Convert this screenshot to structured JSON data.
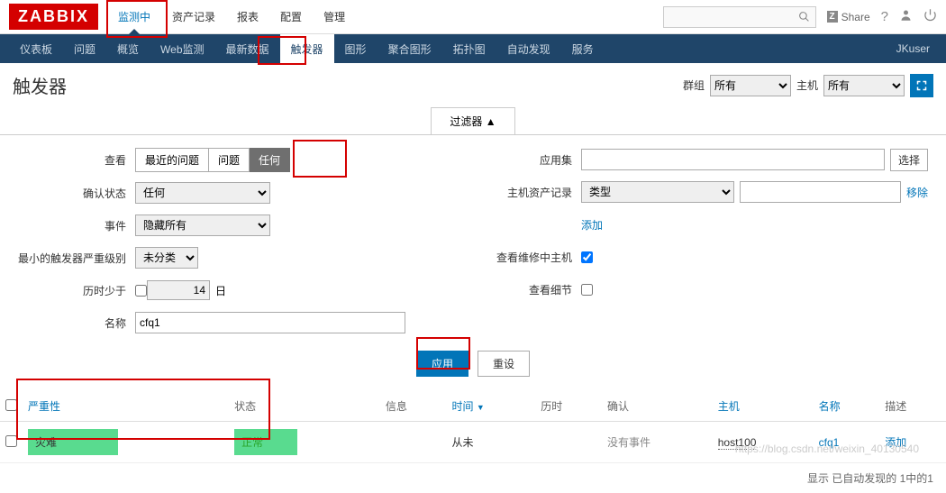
{
  "logo": "ZABBIX",
  "top_menu": [
    "监测中",
    "资产记录",
    "报表",
    "配置",
    "管理"
  ],
  "top_active_index": 0,
  "share_label": "Share",
  "sub_nav": [
    "仪表板",
    "问题",
    "概览",
    "Web监测",
    "最新数据",
    "触发器",
    "图形",
    "聚合图形",
    "拓扑图",
    "自动发现",
    "服务"
  ],
  "sub_active_index": 5,
  "username": "JKuser",
  "page_title": "触发器",
  "header_group_label": "群组",
  "header_group_value": "所有",
  "header_host_label": "主机",
  "header_host_value": "所有",
  "filter_tab": "过滤器 ▲",
  "filter": {
    "view_label": "查看",
    "view_options": [
      "最近的问题",
      "问题",
      "任何"
    ],
    "view_active": 2,
    "ack_label": "确认状态",
    "ack_value": "任何",
    "events_label": "事件",
    "events_value": "隐藏所有",
    "min_sev_label": "最小的触发器严重级别",
    "min_sev_value": "未分类",
    "age_label": "历时少于",
    "age_value": "14",
    "age_unit": "日",
    "name_label": "名称",
    "name_value": "cfq1",
    "appset_label": "应用集",
    "appset_btn": "选择",
    "inv_label": "主机资产记录",
    "inv_value": "类型",
    "inv_remove": "移除",
    "inv_add": "添加",
    "maint_label": "查看维修中主机",
    "maint_checked": true,
    "details_label": "查看细节",
    "details_checked": false,
    "apply_btn": "应用",
    "reset_btn": "重设"
  },
  "table": {
    "headers": {
      "severity": "严重性",
      "status": "状态",
      "info": "信息",
      "time": "时间",
      "age": "历时",
      "ack": "确认",
      "host": "主机",
      "name": "名称",
      "desc": "描述"
    },
    "sort_desc": "▼",
    "row": {
      "severity": "灾难",
      "status": "正常",
      "time": "从未",
      "ack": "没有事件",
      "host": "host100",
      "name": "cfq1",
      "desc": "添加"
    }
  },
  "footer": "显示 已自动发现的 1中的1",
  "watermark": "https://blog.csdn.net/weixin_40130540"
}
